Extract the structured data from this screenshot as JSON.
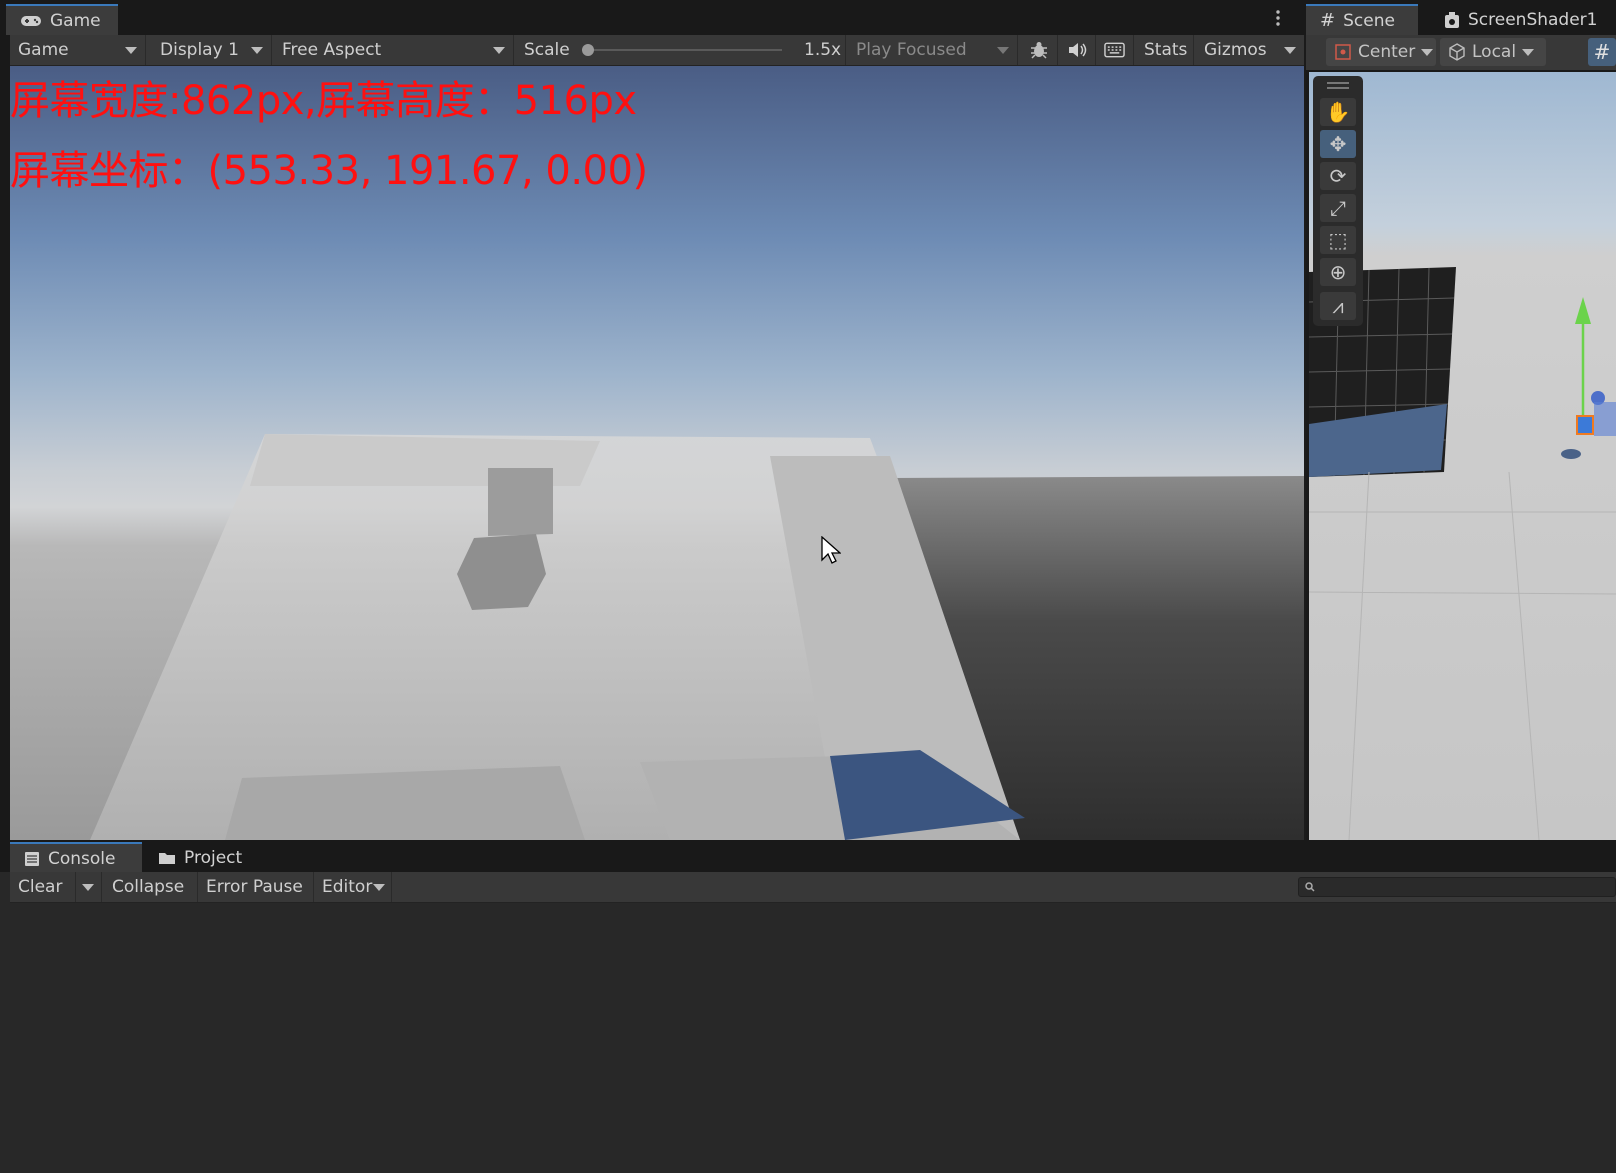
{
  "game_tab": {
    "label": "Game",
    "icon": "gamepad-icon"
  },
  "game_toolbar": {
    "game_dropdown": "Game",
    "display_dropdown": "Display 1",
    "aspect_dropdown": "Free Aspect",
    "scale_label": "Scale",
    "scale_value": "1.5x",
    "play_focused_dropdown": "Play Focused",
    "stats_button": "Stats",
    "gizmos_button": "Gizmos"
  },
  "game_overlay": {
    "screen_size_text": "屏幕宽度:862px,屏幕高度：516px",
    "screen_pos_text": "屏幕坐标：(553.33, 191.67, 0.00)",
    "text_color": "#ff1010"
  },
  "scene_tabs": {
    "scene_label": "Scene",
    "shader_label": "ScreenShader1"
  },
  "scene_toolbar": {
    "pivot_dropdown": "Center",
    "space_dropdown": "Local"
  },
  "console_tabs": {
    "console_label": "Console",
    "project_label": "Project"
  },
  "console_toolbar": {
    "clear_button": "Clear",
    "collapse_button": "Collapse",
    "error_pause_button": "Error Pause",
    "editor_dropdown": "Editor"
  },
  "colors": {
    "accent": "#3a79bb",
    "panel": "#383838",
    "background": "#191919"
  }
}
